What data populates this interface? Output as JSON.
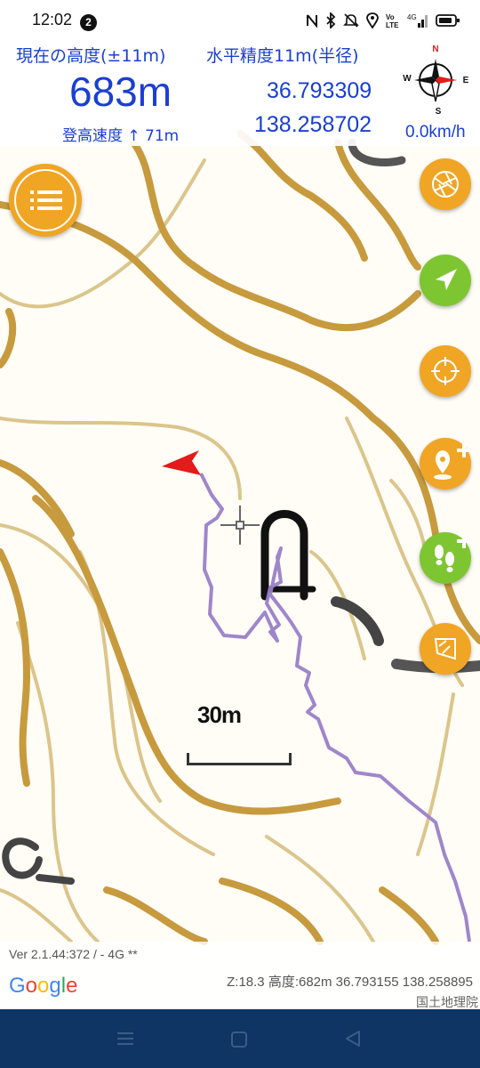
{
  "status_bar": {
    "time": "12:02",
    "notification_count": "2",
    "icons": [
      "nfc-icon",
      "bluetooth-icon",
      "mute-icon",
      "location-icon",
      "volte-icon",
      "signal-4g-icon",
      "battery-icon"
    ],
    "network": "4G"
  },
  "info": {
    "altitude_label": "現在の高度(±11m)",
    "altitude_value": "683m",
    "climb_label": "登高速度 ↑ 71m",
    "horizontal_accuracy": "水平精度11m(半径)",
    "latitude": "36.793309",
    "longitude": "138.258702",
    "speed": "0.0km/h"
  },
  "compass": {
    "n": "N",
    "s": "S",
    "w": "W",
    "e": "E"
  },
  "map": {
    "scale_label": "30m",
    "version": "Ver 2.1.44:372 / - 4G **",
    "logo": "Google",
    "zoom_info": "Z:18.3 高度:682m 36.793155 138.258895",
    "attribution": "国土地理院"
  },
  "buttons": {
    "menu": "menu-icon",
    "layers": "aperture-icon",
    "navigate": "navigate-arrow-icon",
    "target": "crosshair-target-icon",
    "add_point": "add-location-pin-icon",
    "add_track": "add-footprints-icon",
    "flag": "flag-icon"
  },
  "colors": {
    "accent_text": "#1a3fd1",
    "orange_button": "#f0a524",
    "green_button": "#7ec631",
    "track": "#9a80c8",
    "contour": "#c8a04a",
    "nav_bar": "#0f3564"
  }
}
